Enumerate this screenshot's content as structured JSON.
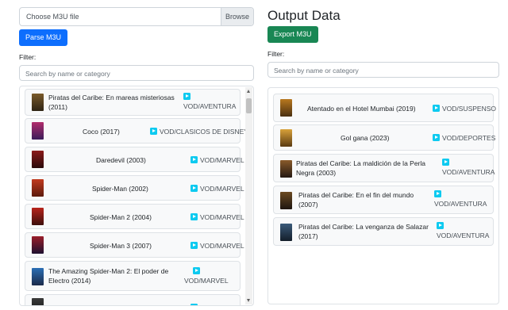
{
  "left": {
    "file_placeholder": "Choose M3U file",
    "browse_label": "Browse",
    "parse_label": "Parse M3U",
    "filter_label": "Filter:",
    "filter_placeholder": "Search by name or category",
    "items": [
      {
        "name": "Piratas del Caribe: En mareas misteriosas (2011)",
        "category": "VOD/AVENTURA"
      },
      {
        "name": "Coco (2017)",
        "category": "VOD/CLASICOS DE DISNEY"
      },
      {
        "name": "Daredevil (2003)",
        "category": "VOD/MARVEL"
      },
      {
        "name": "Spider-Man (2002)",
        "category": "VOD/MARVEL"
      },
      {
        "name": "Spider-Man 2 (2004)",
        "category": "VOD/MARVEL"
      },
      {
        "name": "Spider-Man 3 (2007)",
        "category": "VOD/MARVEL"
      },
      {
        "name": "The Amazing Spider-Man 2: El poder de Electro (2014)",
        "category": "VOD/MARVEL"
      }
    ]
  },
  "right": {
    "title": "Output Data",
    "export_label": "Export M3U",
    "filter_label": "Filter:",
    "filter_placeholder": "Search by name or category",
    "items": [
      {
        "name": "Atentado en el Hotel Mumbai (2019)",
        "category": "VOD/SUSPENSO"
      },
      {
        "name": "Gol gana (2023)",
        "category": "VOD/DEPORTES"
      },
      {
        "name": "Piratas del Caribe: La maldición de la Perla Negra (2003)",
        "category": "VOD/AVENTURA"
      },
      {
        "name": "Piratas del Caribe: En el fin del mundo (2007)",
        "category": "VOD/AVENTURA"
      },
      {
        "name": "Piratas del Caribe: La venganza de Salazar (2017)",
        "category": "VOD/AVENTURA"
      }
    ]
  },
  "colors": {
    "primary": "#0d6efd",
    "success": "#198754",
    "info": "#0dcaf0"
  }
}
